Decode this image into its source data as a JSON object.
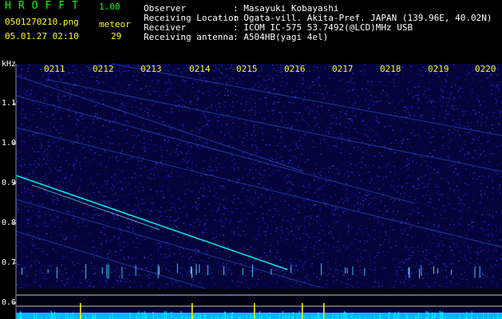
{
  "app": {
    "title": "HROFFT",
    "version": "1.00"
  },
  "file": {
    "name": "0501270210.png",
    "timestamp": "05.01.27 02:10"
  },
  "meteor": {
    "label": "meteor",
    "count": "29"
  },
  "info": [
    {
      "key": "Observer",
      "value": ": Masayuki Kobayashi"
    },
    {
      "key": "Receiving Location",
      "value": ": Ogata-vill. Akita-Pref. JAPAN (139.96E, 40.02N)"
    },
    {
      "key": "Receiver",
      "value": ": ICOM IC-575 53.7492(@LCD)MHz USB"
    },
    {
      "key": "Receiving antenna",
      "value": ": A504HB(yagi 4el)"
    }
  ],
  "axis": {
    "unit": "kHz",
    "freq_ticks": [
      "1.1",
      "1.0",
      "0.9",
      "0.8",
      "0.7",
      "0.6"
    ],
    "time_ticks": [
      "0211",
      "0212",
      "0213",
      "0214",
      "0215",
      "0216",
      "0217",
      "0218",
      "0219",
      "0220"
    ]
  },
  "colors": {
    "background": "#000000",
    "noise": "#1a1ab8",
    "signal": "#00ffff",
    "label_yellow": "#ffff00",
    "label_green": "#00ff00",
    "baseline": "#00b4ff"
  }
}
